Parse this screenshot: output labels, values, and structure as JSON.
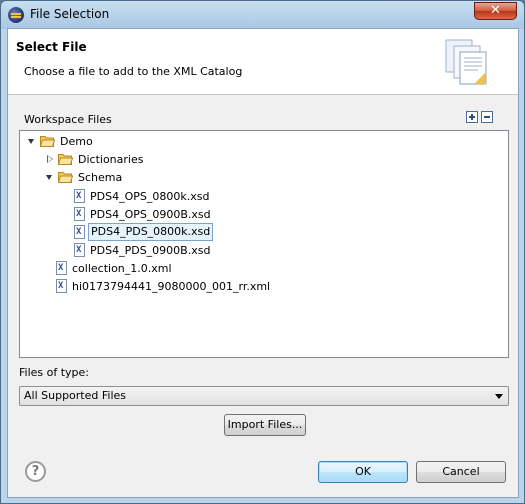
{
  "window": {
    "title": "File Selection"
  },
  "header": {
    "title": "Select File",
    "description": "Choose a file to add to the XML Catalog"
  },
  "workspace": {
    "label": "Workspace Files",
    "icons": {
      "expand_all": "expand-all-icon",
      "collapse_all": "collapse-all-icon"
    },
    "tree": {
      "root": "Demo",
      "dictionaries": "Dictionaries",
      "schema": "Schema",
      "schema_files": [
        "PDS4_OPS_0800k.xsd",
        "PDS4_OPS_0900B.xsd",
        "PDS4_PDS_0800k.xsd",
        "PDS4_PDS_0900B.xsd"
      ],
      "selected": "PDS4_PDS_0800k.xsd",
      "root_files": [
        "collection_1.0.xml",
        "hi0173794441_9080000_001_rr.xml"
      ]
    }
  },
  "files_of_type": {
    "label": "Files of type:",
    "selected": "All Supported Files"
  },
  "buttons": {
    "import": "Import Files...",
    "ok": "OK",
    "cancel": "Cancel",
    "help": "?"
  },
  "colors": {
    "selection_bg": "#e5f3fb",
    "selection_border": "#7da2ce",
    "folder": "#f3c663"
  }
}
